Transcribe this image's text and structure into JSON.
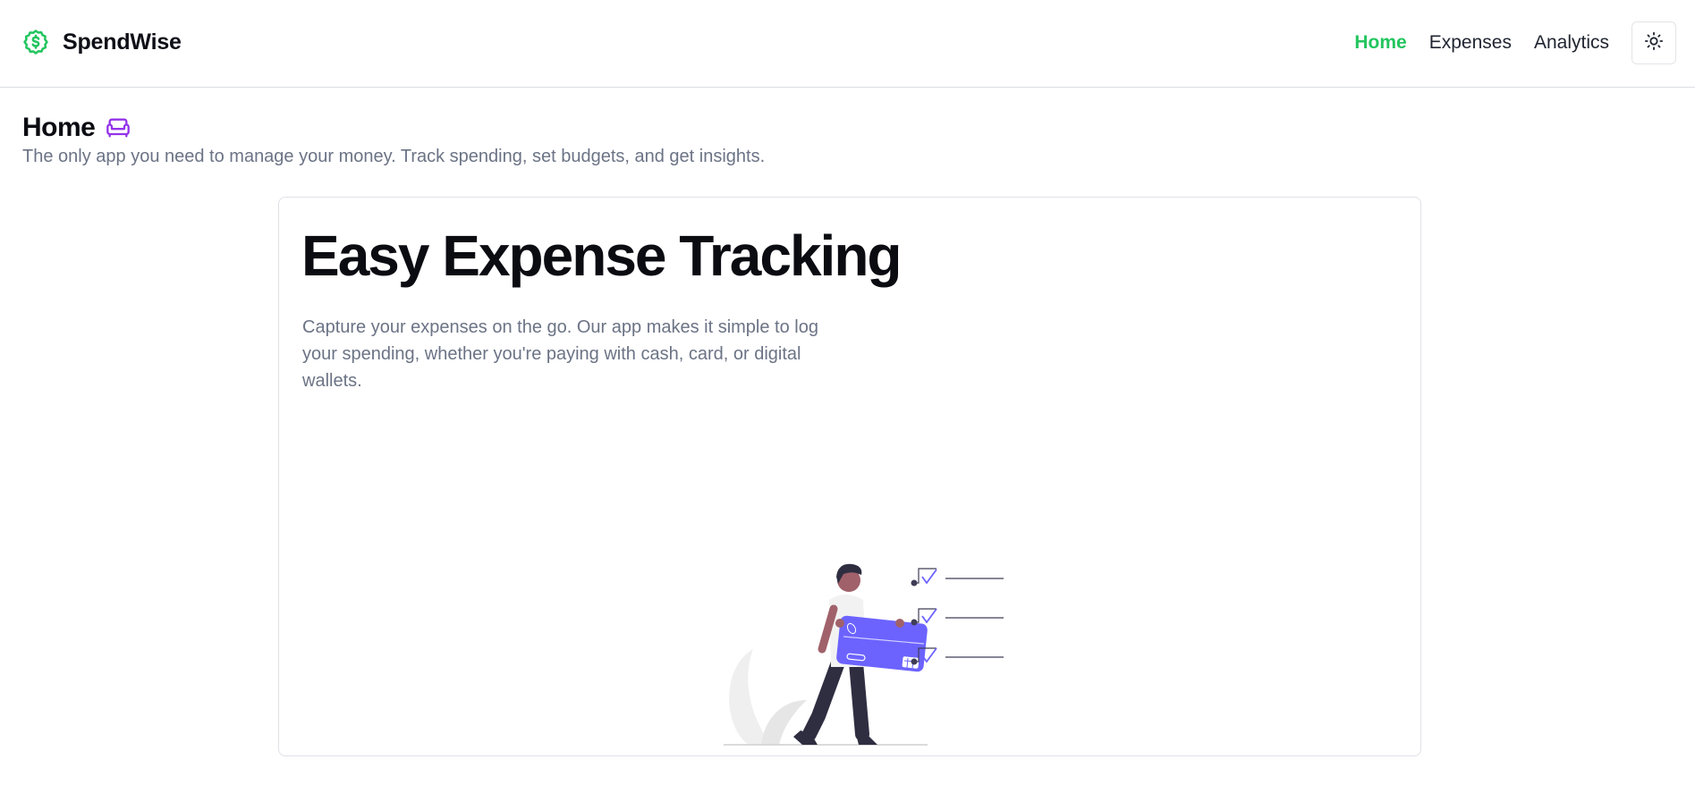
{
  "brand": {
    "name": "SpendWise",
    "icon": "dollar-badge-icon",
    "color": "#22c55e"
  },
  "nav": {
    "items": [
      {
        "label": "Home",
        "active": true
      },
      {
        "label": "Expenses",
        "active": false
      },
      {
        "label": "Analytics",
        "active": false
      }
    ],
    "theme_toggle_icon": "sun-icon"
  },
  "page": {
    "title": "Home",
    "title_icon": "sofa-icon",
    "title_icon_color": "#9333ea",
    "subtitle": "The only app you need to manage your money. Track spending, set budgets, and get insights."
  },
  "feature_card": {
    "title": "Easy Expense Tracking",
    "description": "Capture your expenses on the go. Our app makes it simple to log your spending, whether you're paying with cash, card, or digital wallets.",
    "illustration": "person-holding-credit-card-illustration",
    "accent_color": "#6c63ff"
  }
}
